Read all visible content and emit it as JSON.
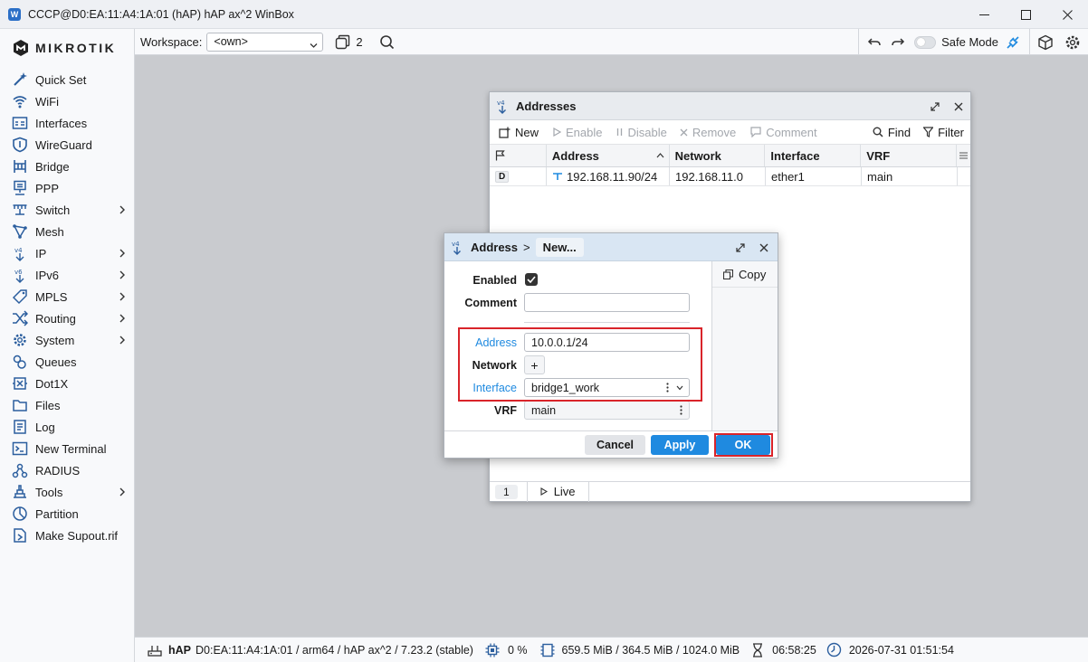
{
  "window": {
    "title": "CCCP@D0:EA:11:A4:1A:01 (hAP) hAP ax^2 WinBox",
    "app_icon": "winbox-icon"
  },
  "brand": {
    "name": "MIKROTIK"
  },
  "sidebar": {
    "items": [
      {
        "label": "Quick Set",
        "icon": "wand-icon",
        "submenu": false
      },
      {
        "label": "WiFi",
        "icon": "wifi-icon",
        "submenu": false
      },
      {
        "label": "Interfaces",
        "icon": "interfaces-icon",
        "submenu": false
      },
      {
        "label": "WireGuard",
        "icon": "shield-icon",
        "submenu": false
      },
      {
        "label": "Bridge",
        "icon": "bridge-icon",
        "submenu": false
      },
      {
        "label": "PPP",
        "icon": "ppp-icon",
        "submenu": false
      },
      {
        "label": "Switch",
        "icon": "switch-icon",
        "submenu": true
      },
      {
        "label": "Mesh",
        "icon": "mesh-icon",
        "submenu": false
      },
      {
        "label": "IP",
        "icon": "ip-icon",
        "submenu": true
      },
      {
        "label": "IPv6",
        "icon": "ipv6-icon",
        "submenu": true
      },
      {
        "label": "MPLS",
        "icon": "tag-icon",
        "submenu": true
      },
      {
        "label": "Routing",
        "icon": "routing-icon",
        "submenu": true
      },
      {
        "label": "System",
        "icon": "gear-icon",
        "submenu": true
      },
      {
        "label": "Queues",
        "icon": "queues-icon",
        "submenu": false
      },
      {
        "label": "Dot1X",
        "icon": "dot1x-icon",
        "submenu": false
      },
      {
        "label": "Files",
        "icon": "files-icon",
        "submenu": false
      },
      {
        "label": "Log",
        "icon": "log-icon",
        "submenu": false
      },
      {
        "label": "New Terminal",
        "icon": "terminal-icon",
        "submenu": false
      },
      {
        "label": "RADIUS",
        "icon": "radius-icon",
        "submenu": false
      },
      {
        "label": "Tools",
        "icon": "tools-icon",
        "submenu": true
      },
      {
        "label": "Partition",
        "icon": "partition-icon",
        "submenu": false
      },
      {
        "label": "Make Supout.rif",
        "icon": "supout-icon",
        "submenu": false
      }
    ]
  },
  "topbar": {
    "workspace_label": "Workspace:",
    "workspace_value": "<own>",
    "windows_count": "2",
    "safe_mode_label": "Safe Mode"
  },
  "addresses": {
    "title": "Addresses",
    "title_icon": "ipv4-icon",
    "toolbar": {
      "new": "New",
      "enable": "Enable",
      "disable": "Disable",
      "remove": "Remove",
      "comment": "Comment",
      "find": "Find",
      "filter": "Filter"
    },
    "columns": [
      "Address",
      "Network",
      "Interface",
      "VRF"
    ],
    "rows": [
      {
        "flag": "D",
        "address": "192.168.11.90/24",
        "network": "192.168.11.0",
        "interface": "ether1",
        "vrf": "main"
      }
    ],
    "pager": {
      "page": "1",
      "live": "Live"
    }
  },
  "dialog": {
    "crumb_root": "Address",
    "crumb_sep": ">",
    "crumb_current": "New...",
    "copy": "Copy",
    "fields": {
      "enabled_label": "Enabled",
      "comment_label": "Comment",
      "comment_value": "",
      "address_label": "Address",
      "address_value": "10.0.0.1/24",
      "network_label": "Network",
      "network_add": "+",
      "interface_label": "Interface",
      "interface_value": "bridge1_work",
      "vrf_label": "VRF",
      "vrf_value": "main"
    },
    "buttons": {
      "cancel": "Cancel",
      "apply": "Apply",
      "ok": "OK"
    }
  },
  "statusbar": {
    "device": "hAP",
    "info": "D0:EA:11:A4:1A:01 / arm64 / hAP ax^2 / 7.23.2 (stable)",
    "cpu": "0 %",
    "memory": "659.5 MiB / 364.5 MiB / 1024.0 MiB",
    "uptime": "06:58:25",
    "datetime": "2026-07-31 01:51:54"
  },
  "colors": {
    "accent": "#1f8ae0",
    "highlight": "#d9242a"
  }
}
